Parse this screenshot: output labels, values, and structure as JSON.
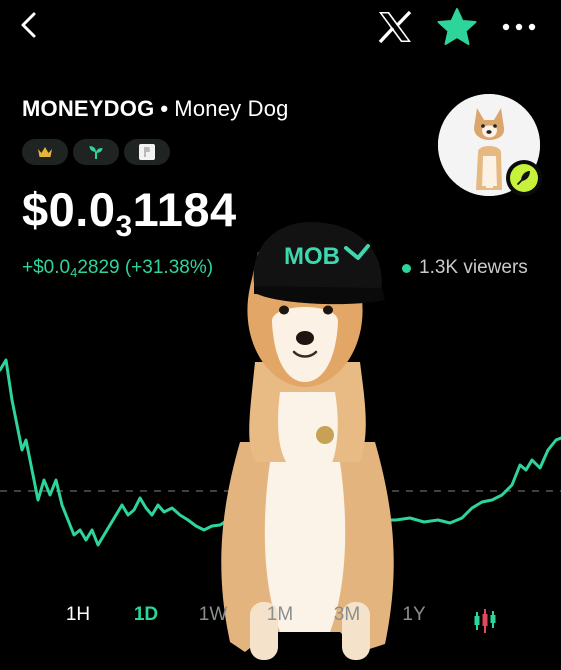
{
  "header": {
    "back_icon": "chevron-left-icon",
    "x_icon": "x-logo-icon",
    "watchlist_icon": "star-icon",
    "more_icon": "more-dots-icon"
  },
  "token": {
    "symbol": "MONEYDOG",
    "separator": "•",
    "name": "Money Dog",
    "badges": [
      "crown-icon",
      "sprout-icon",
      "website-icon"
    ],
    "price_prefix": "$0.0",
    "price_sub": "3",
    "price_tail": "1184",
    "change_prefix": "+$0.0",
    "change_sub": "4",
    "change_tail": "2829 (+31.38%)",
    "viewers": "1.3K viewers"
  },
  "cap_text": "MOB",
  "colors": {
    "accent": "#2ed59a",
    "background": "#000000",
    "badge_bg": "#1f2322",
    "avatar_badge": "#c7f23b"
  },
  "ranges": {
    "items": [
      "1H",
      "1D",
      "1W",
      "1M",
      "3M",
      "1Y"
    ],
    "selected": "1D",
    "chart_toggle_icon": "candlestick-icon"
  }
}
